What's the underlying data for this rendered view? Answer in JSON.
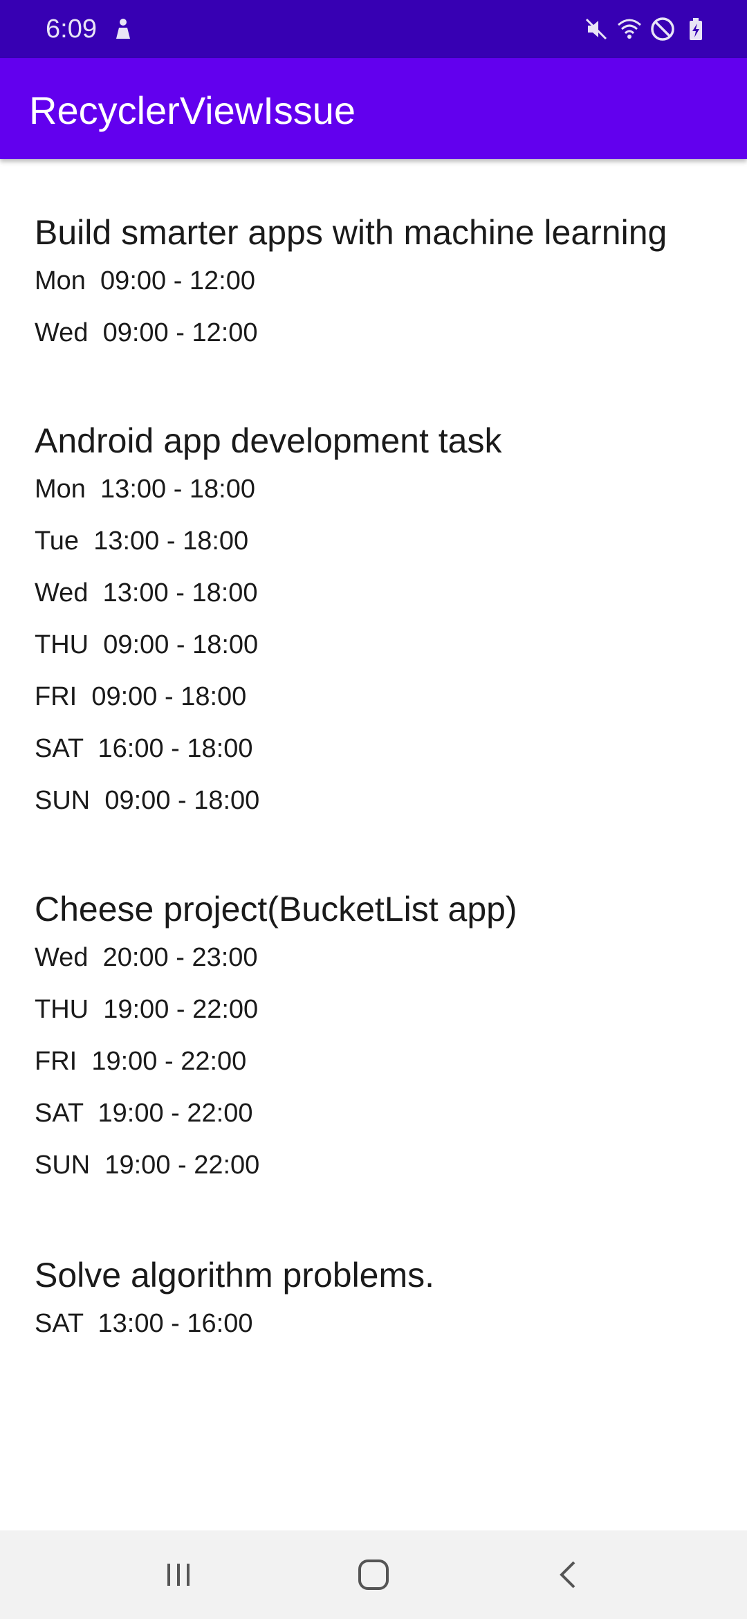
{
  "status_bar": {
    "time": "6:09",
    "icons": [
      "notification-person-icon",
      "mute-icon",
      "wifi-icon",
      "do-not-disturb-icon",
      "battery-charging-icon"
    ]
  },
  "app_bar": {
    "title": "RecyclerViewIssue"
  },
  "tasks": [
    {
      "title": "Build smarter apps with machine learning",
      "entries": [
        {
          "day": "Mon",
          "time": "09:00 - 12:00"
        },
        {
          "day": "Wed",
          "time": "09:00 - 12:00"
        }
      ]
    },
    {
      "title": "Android app development task",
      "entries": [
        {
          "day": "Mon",
          "time": "13:00 - 18:00"
        },
        {
          "day": "Tue",
          "time": "13:00 - 18:00"
        },
        {
          "day": "Wed",
          "time": "13:00 - 18:00"
        },
        {
          "day": "THU",
          "time": "09:00 - 18:00"
        },
        {
          "day": "FRI",
          "time": "09:00 - 18:00"
        },
        {
          "day": "SAT",
          "time": "16:00 - 18:00"
        },
        {
          "day": "SUN",
          "time": "09:00 - 18:00"
        }
      ]
    },
    {
      "title": "Cheese project(BucketList app)",
      "entries": [
        {
          "day": "Wed",
          "time": "20:00 - 23:00"
        },
        {
          "day": "THU",
          "time": "19:00 - 22:00"
        },
        {
          "day": "FRI",
          "time": "19:00 - 22:00"
        },
        {
          "day": "SAT",
          "time": "19:00 - 22:00"
        },
        {
          "day": "SUN",
          "time": "19:00 - 22:00"
        }
      ]
    },
    {
      "title": "Solve algorithm problems.",
      "entries": [
        {
          "day": "SAT",
          "time": "13:00 - 16:00"
        }
      ]
    }
  ],
  "nav_bar": {
    "buttons": [
      "recent-apps-icon",
      "home-icon",
      "back-icon"
    ]
  },
  "colors": {
    "status_bar": "#3700B3",
    "app_bar": "#6200EE",
    "nav_bar": "#f2f2f2"
  }
}
